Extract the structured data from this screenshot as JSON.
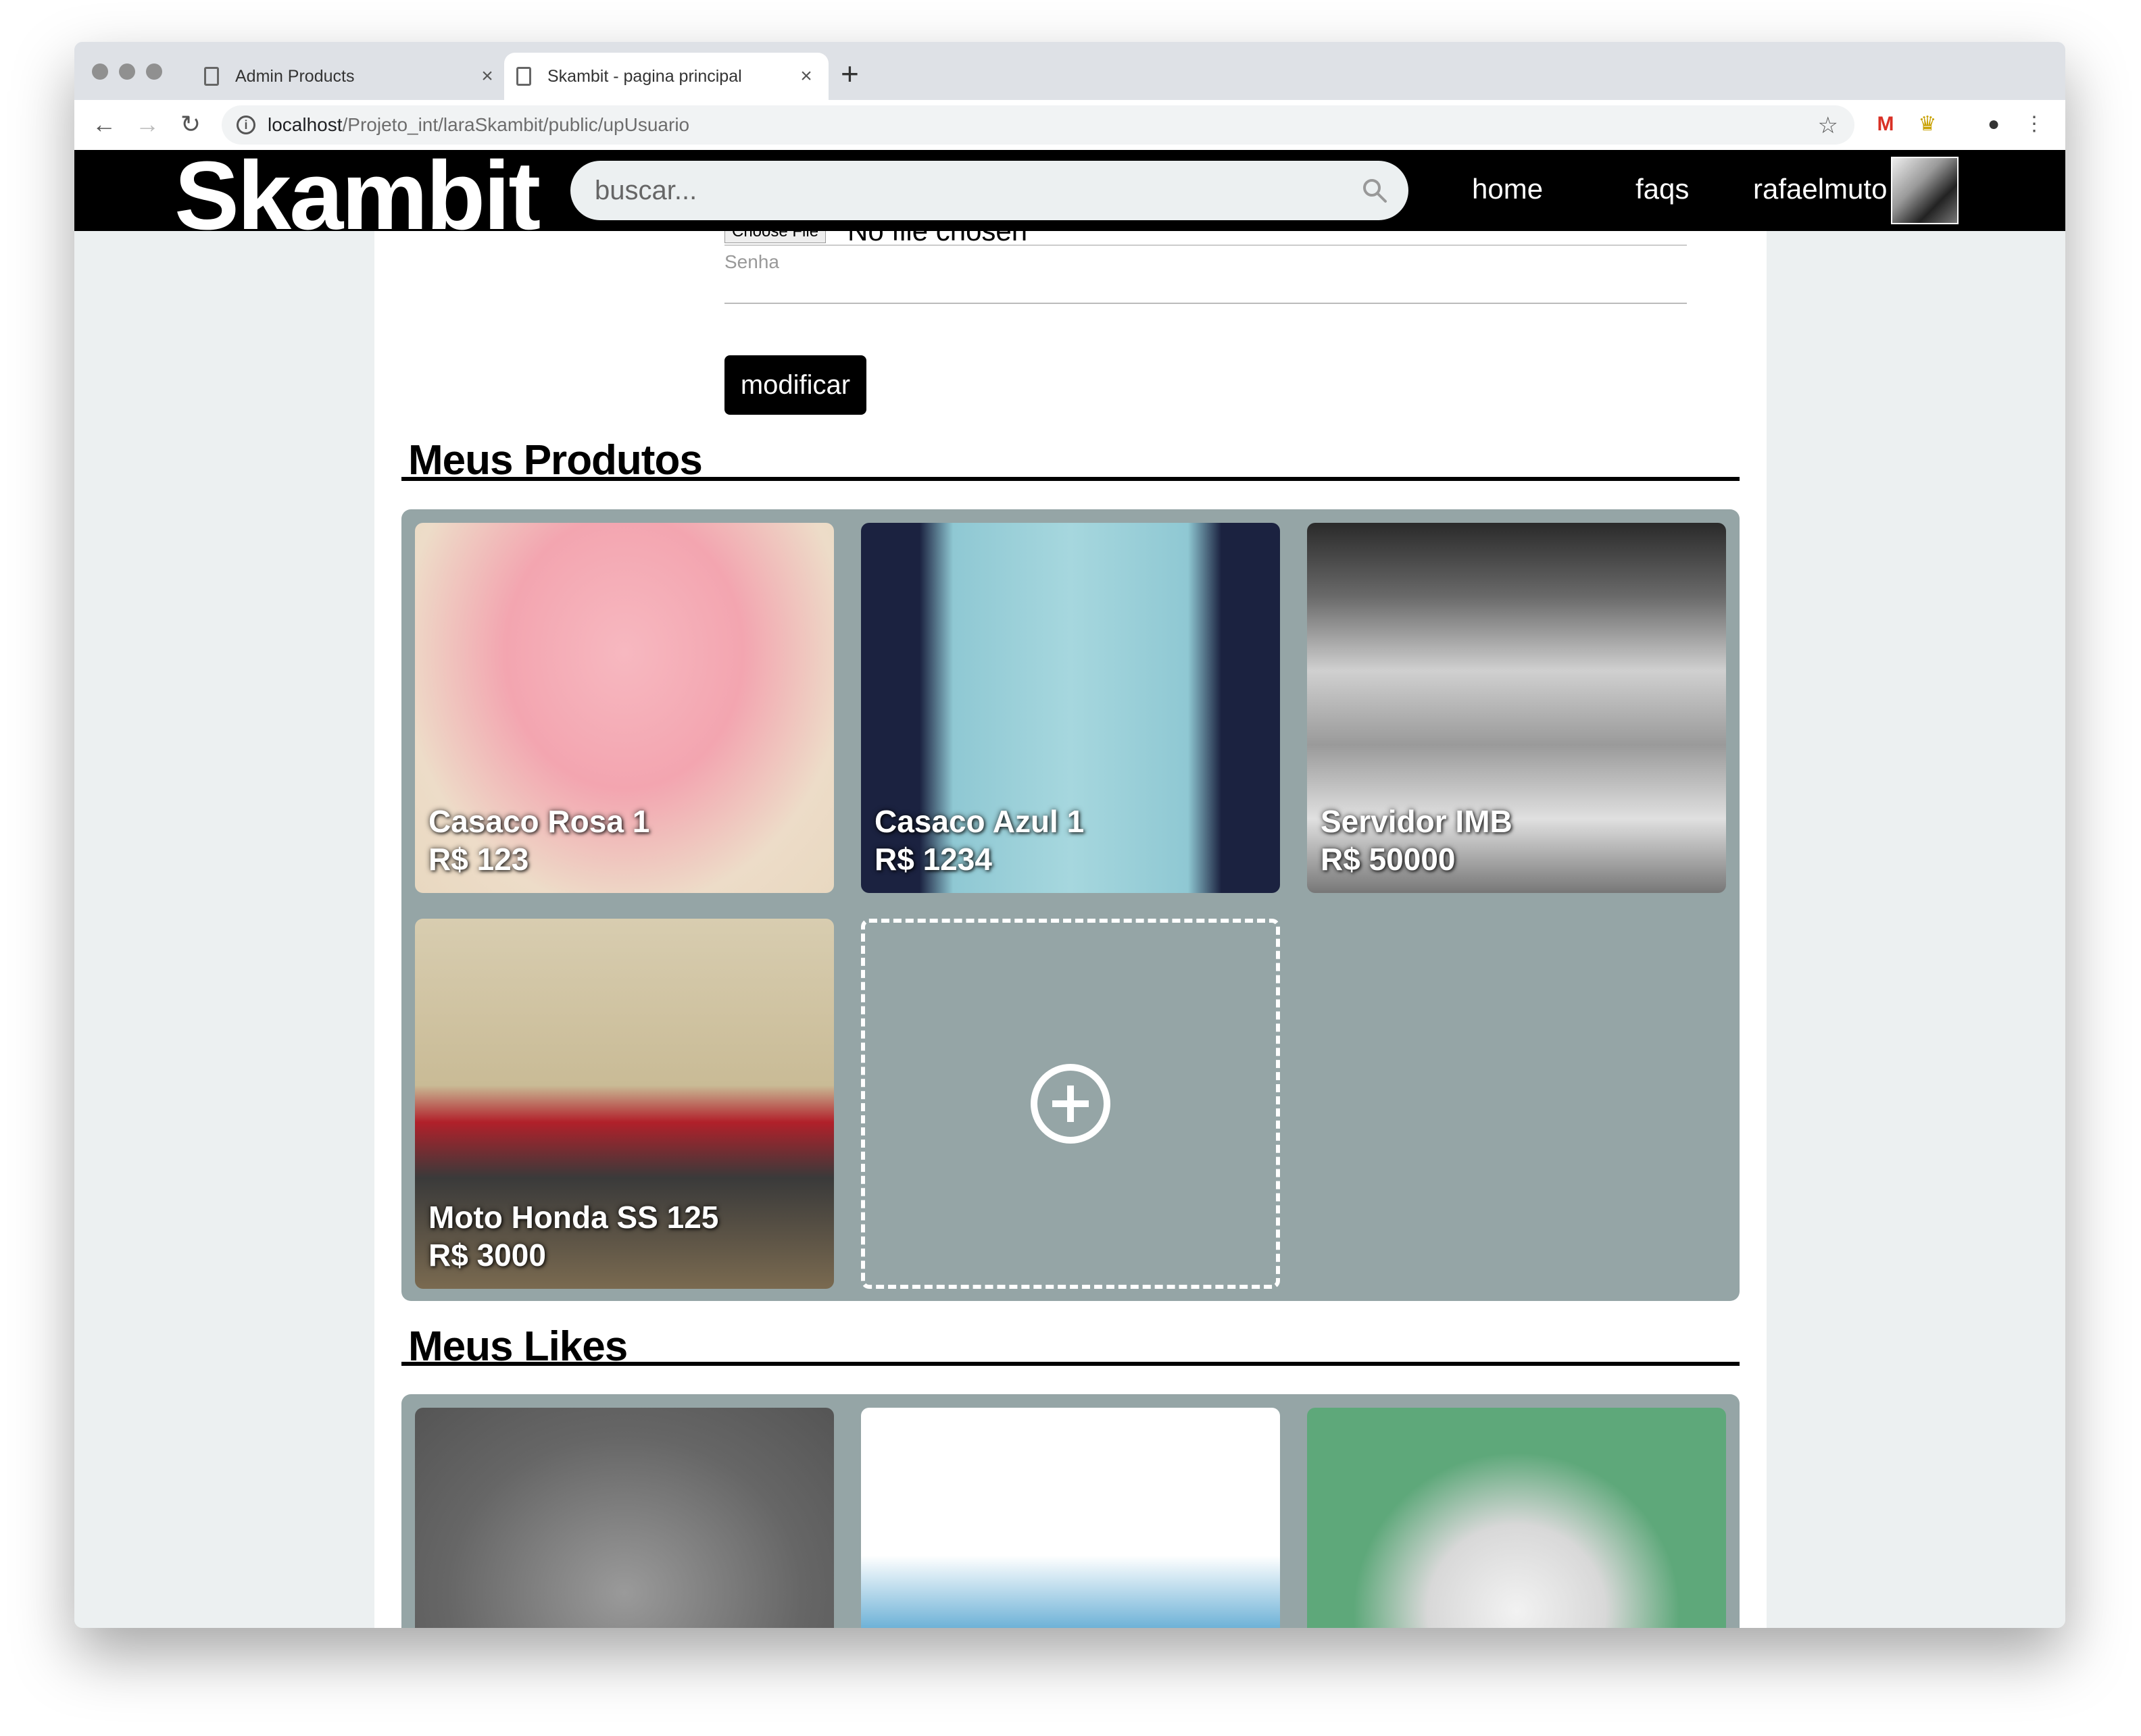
{
  "browser": {
    "tabs": [
      {
        "title": "Admin Products"
      },
      {
        "title": "Skambit - pagina principal"
      }
    ],
    "url_host": "localhost",
    "url_path": "/Projeto_int/laraSkambit/public/upUsuario"
  },
  "site": {
    "logo": "Skambit",
    "search_placeholder": "buscar...",
    "nav": {
      "home": "home",
      "faqs": "faqs",
      "user": "rafaelmuto"
    }
  },
  "form": {
    "choose_file": "Choose File",
    "no_file": "No file chosen",
    "senha_label": "Senha",
    "submit": "modificar"
  },
  "sections": {
    "produtos_title": "Meus Produtos",
    "likes_title": "Meus Likes"
  },
  "produtos": [
    {
      "name": "Casaco Rosa 1",
      "price": "R$ 123"
    },
    {
      "name": "Casaco Azul 1",
      "price": "R$ 1234"
    },
    {
      "name": "Servidor IMB",
      "price": "R$ 50000"
    },
    {
      "name": "Moto Honda SS 125",
      "price": "R$ 3000"
    }
  ],
  "likes": [
    {
      "image": "figure"
    },
    {
      "image": "cafe-racer-motorcycle"
    },
    {
      "image": "air-cooler"
    }
  ],
  "colors": {
    "header": "#000000",
    "page_bg": "#ecf0f1",
    "panel": "#95a5a6"
  }
}
